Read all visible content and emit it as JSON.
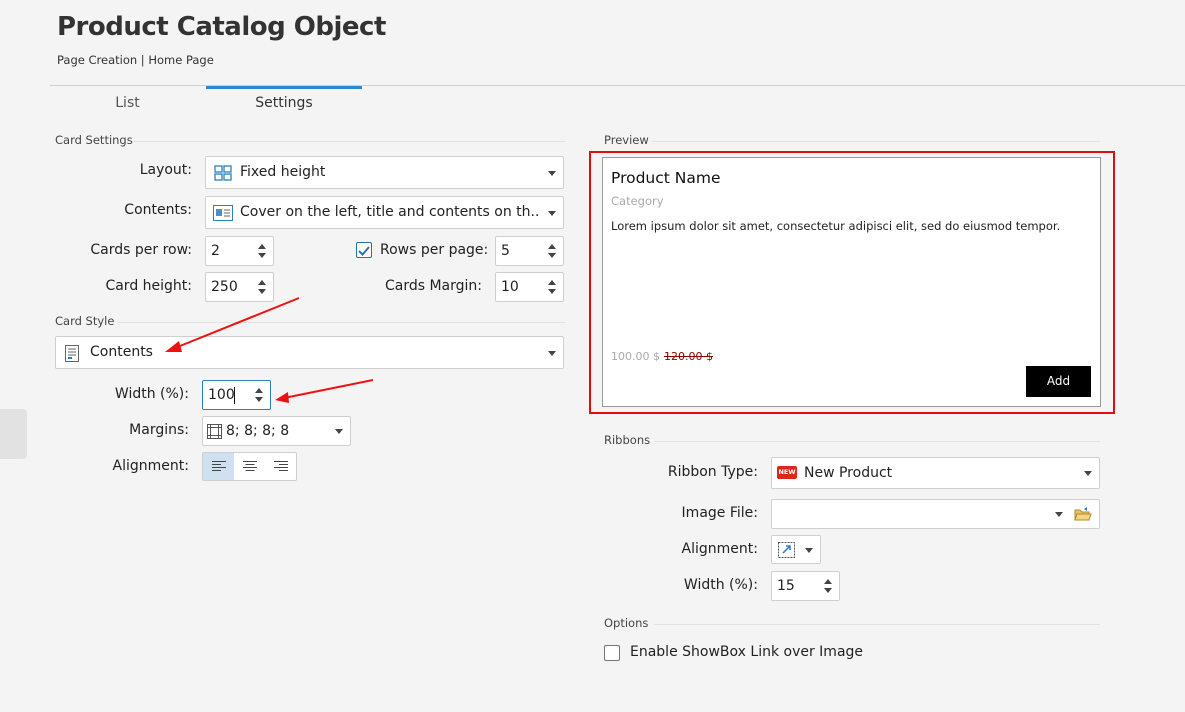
{
  "header": {
    "title": "Product Catalog Object",
    "breadcrumb": "Page Creation | Home Page"
  },
  "tabs": [
    {
      "label": "List",
      "active": false
    },
    {
      "label": "Settings",
      "active": true
    }
  ],
  "card_settings": {
    "section": "Card Settings",
    "layout_label": "Layout:",
    "layout_value": "Fixed height",
    "contents_label": "Contents:",
    "contents_value": "Cover on the left, title and contents on th...",
    "cards_per_row_label": "Cards per row:",
    "cards_per_row_value": "2",
    "rows_per_page_label": "Rows per page:",
    "rows_per_page_value": "5",
    "rows_per_page_checked": true,
    "card_height_label": "Card height:",
    "card_height_value": "250",
    "cards_margin_label": "Cards Margin:",
    "cards_margin_value": "10"
  },
  "card_style": {
    "section": "Card Style",
    "style_value": "Contents",
    "width_label": "Width (%):",
    "width_value": "100",
    "margins_label": "Margins:",
    "margins_value": "8; 8; 8; 8",
    "alignment_label": "Alignment:",
    "alignment_selected": "left"
  },
  "preview": {
    "section": "Preview",
    "product_name": "Product Name",
    "category": "Category",
    "description": "Lorem ipsum dolor sit amet, consectetur adipisci elit, sed do eiusmod tempor.",
    "price": "100.00 $",
    "old_price": "120.00 $",
    "add_button": "Add"
  },
  "ribbons": {
    "section": "Ribbons",
    "type_label": "Ribbon Type:",
    "type_value": "New Product",
    "type_badge": "NEW",
    "image_label": "Image File:",
    "image_value": "",
    "alignment_label": "Alignment:",
    "width_label": "Width (%):",
    "width_value": "15"
  },
  "options": {
    "section": "Options",
    "showbox_label": "Enable ShowBox Link over Image",
    "showbox_checked": false
  },
  "colors": {
    "accent": "#2a8ad6",
    "highlight": "#e10e0e",
    "button_bg": "#000000"
  }
}
